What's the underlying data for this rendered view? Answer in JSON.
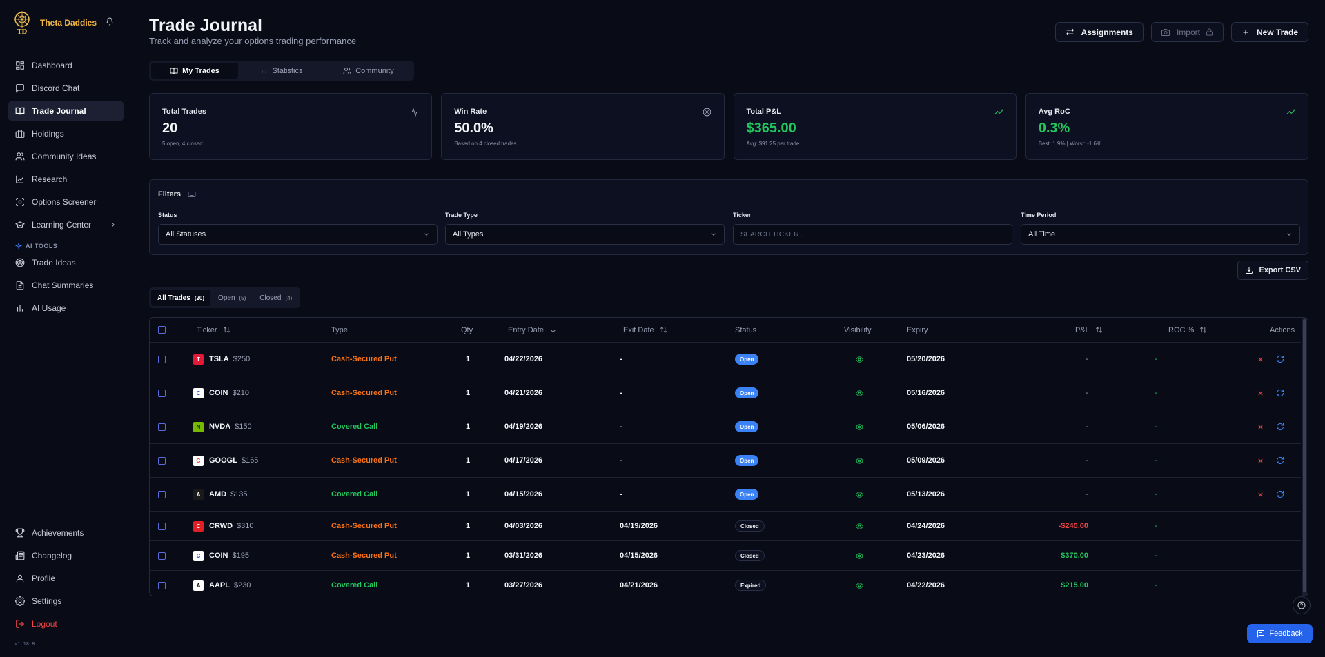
{
  "brand": {
    "name": "Theta Daddies",
    "logo_text": "TD"
  },
  "nav": [
    {
      "label": "Dashboard",
      "icon": "dashboard-icon"
    },
    {
      "label": "Discord Chat",
      "icon": "chat-icon"
    },
    {
      "label": "Trade Journal",
      "icon": "book-icon",
      "active": true
    },
    {
      "label": "Holdings",
      "icon": "briefcase-icon"
    },
    {
      "label": "Community Ideas",
      "icon": "users-icon"
    },
    {
      "label": "Research",
      "icon": "chart-line-icon"
    },
    {
      "label": "Options Screener",
      "icon": "scan-icon"
    },
    {
      "label": "Learning Center",
      "icon": "graduation-cap-icon"
    }
  ],
  "ai_section": {
    "label": "AI TOOLS"
  },
  "ai_nav": [
    {
      "label": "Trade Ideas",
      "icon": "target-icon"
    },
    {
      "label": "Chat Summaries",
      "icon": "document-icon"
    },
    {
      "label": "AI Usage",
      "icon": "bar-chart-icon"
    }
  ],
  "bottom_nav": [
    {
      "label": "Achievements",
      "icon": "trophy-icon"
    },
    {
      "label": "Changelog",
      "icon": "newspaper-icon"
    },
    {
      "label": "Profile",
      "icon": "user-icon"
    },
    {
      "label": "Settings",
      "icon": "gear-icon"
    },
    {
      "label": "Logout",
      "icon": "logout-icon"
    }
  ],
  "version": "v1.18.8",
  "header": {
    "title": "Trade Journal",
    "subtitle": "Track and analyze your options trading performance",
    "assignments_label": "Assignments",
    "import_label": "Import",
    "new_trade_label": "New Trade"
  },
  "tabs": [
    "My Trades",
    "Statistics",
    "Community"
  ],
  "stats": [
    {
      "title": "Total Trades",
      "value": "20",
      "sub": "5 open, 4 closed",
      "icon": "activity-icon",
      "accent": "#f3f4f8"
    },
    {
      "title": "Win Rate",
      "value": "50.0%",
      "sub": "Based on 4 closed trades",
      "icon": "target-icon",
      "accent": "#f3f4f8"
    },
    {
      "title": "Total P&L",
      "value": "$365.00",
      "sub": "Avg: $91.25 per trade",
      "icon": "trending-up-icon",
      "accent": "#22c55e"
    },
    {
      "title": "Avg RoC",
      "value": "0.3%",
      "sub": "Best: 1.9% | Worst: -1.6%",
      "icon": "trending-up-icon",
      "accent": "#22c55e"
    }
  ],
  "filters": {
    "title": "Filters",
    "status": {
      "label": "Status",
      "value": "All Statuses"
    },
    "trade_type": {
      "label": "Trade Type",
      "value": "All Types"
    },
    "ticker": {
      "label": "Ticker",
      "placeholder": "SEARCH TICKER..."
    },
    "time_period": {
      "label": "Time Period",
      "value": "All Time"
    }
  },
  "export_label": "Export CSV",
  "subtabs": [
    {
      "label": "All Trades",
      "count": "(20)"
    },
    {
      "label": "Open",
      "count": "(5)"
    },
    {
      "label": "Closed",
      "count": "(4)"
    }
  ],
  "table": {
    "headers": {
      "ticker": "Ticker",
      "type": "Type",
      "qty": "Qty",
      "entry": "Entry Date",
      "exit": "Exit Date",
      "status": "Status",
      "visibility": "Visibility",
      "expiry": "Expiry",
      "pl": "P&L",
      "roc": "ROC %",
      "actions": "Actions"
    },
    "rows": [
      {
        "ticker": "TSLA",
        "strike": "$250",
        "type": "Cash-Secured Put",
        "qty": "1",
        "entry": "04/22/2026",
        "exit": "-",
        "status": "Open",
        "expiry": "05/20/2026",
        "pl": "-",
        "roc": "-",
        "logo_bg": "#e31937",
        "logo_fg": "#ffffff",
        "logo_char": "T"
      },
      {
        "ticker": "COIN",
        "strike": "$210",
        "type": "Cash-Secured Put",
        "qty": "1",
        "entry": "04/21/2026",
        "exit": "-",
        "status": "Open",
        "expiry": "05/16/2026",
        "pl": "-",
        "roc": "-",
        "logo_bg": "#ffffff",
        "logo_fg": "#1652f0",
        "logo_char": "C"
      },
      {
        "ticker": "NVDA",
        "strike": "$150",
        "type": "Covered Call",
        "qty": "1",
        "entry": "04/19/2026",
        "exit": "-",
        "status": "Open",
        "expiry": "05/06/2026",
        "pl": "-",
        "roc": "-",
        "logo_bg": "#76b900",
        "logo_fg": "#1a2b00",
        "logo_char": "N"
      },
      {
        "ticker": "GOOGL",
        "strike": "$165",
        "type": "Cash-Secured Put",
        "qty": "1",
        "entry": "04/17/2026",
        "exit": "-",
        "status": "Open",
        "expiry": "05/09/2026",
        "pl": "-",
        "roc": "-",
        "logo_bg": "#ffffff",
        "logo_fg": "#ea4335",
        "logo_char": "G"
      },
      {
        "ticker": "AMD",
        "strike": "$135",
        "type": "Covered Call",
        "qty": "1",
        "entry": "04/15/2026",
        "exit": "-",
        "status": "Open",
        "expiry": "05/13/2026",
        "pl": "-",
        "roc": "-",
        "logo_bg": "#1a1a1a",
        "logo_fg": "#ffffff",
        "logo_char": "A"
      },
      {
        "ticker": "CRWD",
        "strike": "$310",
        "type": "Cash-Secured Put",
        "qty": "1",
        "entry": "04/03/2026",
        "exit": "04/19/2026",
        "status": "Closed",
        "expiry": "04/24/2026",
        "pl": "-$240.00",
        "roc": "-",
        "logo_bg": "#e01f26",
        "logo_fg": "#ffffff",
        "logo_char": "C"
      },
      {
        "ticker": "COIN",
        "strike": "$195",
        "type": "Cash-Secured Put",
        "qty": "1",
        "entry": "03/31/2026",
        "exit": "04/15/2026",
        "status": "Closed",
        "expiry": "04/23/2026",
        "pl": "$370.00",
        "roc": "-",
        "logo_bg": "#ffffff",
        "logo_fg": "#1652f0",
        "logo_char": "C"
      },
      {
        "ticker": "AAPL",
        "strike": "$230",
        "type": "Covered Call",
        "qty": "1",
        "entry": "03/27/2026",
        "exit": "04/21/2026",
        "status": "Expired",
        "expiry": "04/22/2026",
        "pl": "$215.00",
        "roc": "-",
        "logo_bg": "#ffffff",
        "logo_fg": "#000000",
        "logo_char": "A"
      }
    ]
  },
  "feedback_label": "Feedback",
  "colors": {
    "accent_gold": "#f5b841",
    "green": "#22c55e",
    "red": "#ef4444",
    "orange": "#f97316",
    "blue": "#3b82f6"
  }
}
